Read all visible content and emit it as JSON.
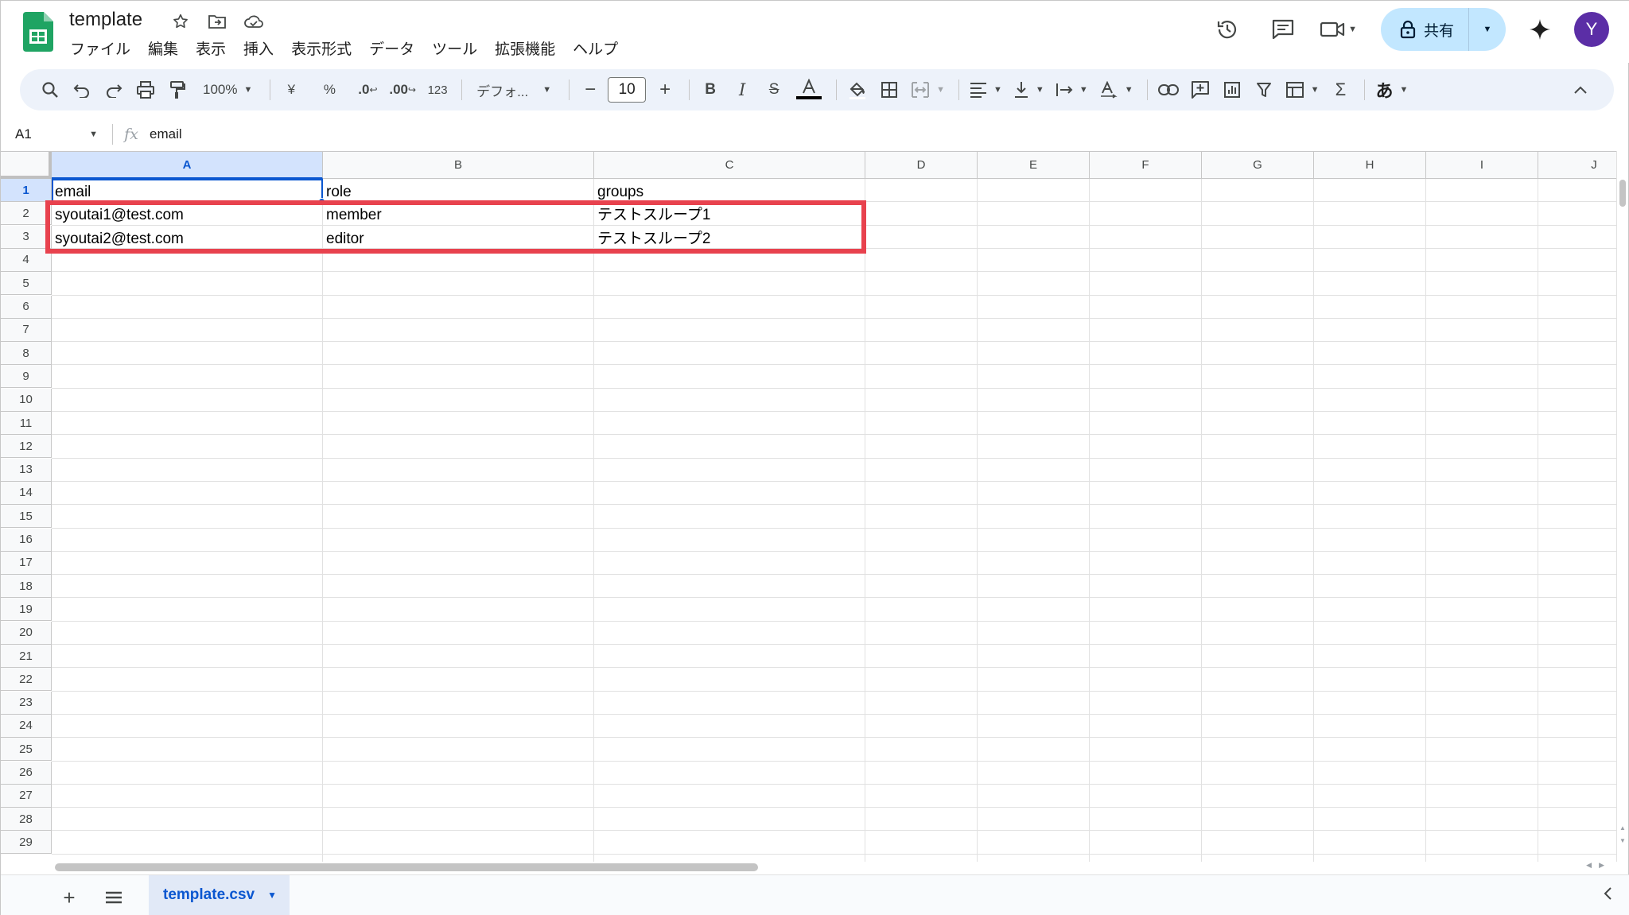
{
  "doc": {
    "title": "template"
  },
  "menu": [
    "ファイル",
    "編集",
    "表示",
    "挿入",
    "表示形式",
    "データ",
    "ツール",
    "拡張機能",
    "ヘルプ"
  ],
  "share": {
    "label": "共有"
  },
  "avatar": {
    "initial": "Y",
    "color": "#5b2ea6"
  },
  "toolbar": {
    "zoom": "100%",
    "currency": "¥",
    "percent": "%",
    "dec_decrease": ".0",
    "dec_increase": ".00",
    "format_more": "123",
    "font": "デフォ...",
    "font_size": "10",
    "input_method": "あ"
  },
  "formula_bar": {
    "name_box": "A1",
    "fx": "fx",
    "value": "email"
  },
  "columns": [
    "A",
    "B",
    "C",
    "D",
    "E",
    "F",
    "G",
    "H",
    "I",
    "J"
  ],
  "rows": [
    "1",
    "2",
    "3",
    "4",
    "5",
    "6",
    "7",
    "8",
    "9",
    "10",
    "11",
    "12",
    "13",
    "14",
    "15",
    "16",
    "17",
    "18",
    "19",
    "20",
    "21",
    "22",
    "23",
    "24",
    "25",
    "26",
    "27",
    "28",
    "29"
  ],
  "cells": {
    "r1": [
      "email",
      "role",
      "groups"
    ],
    "r2": [
      "syoutai1@test.com",
      "member",
      "テストスループ1"
    ],
    "r3": [
      "syoutai2@test.com",
      "editor",
      "テストスループ2"
    ]
  },
  "sheets": [
    {
      "name": "template.csv"
    }
  ],
  "colors": {
    "highlight": "#e8424e",
    "accent": "#0b57d0",
    "share_bg": "#c2e7ff"
  }
}
